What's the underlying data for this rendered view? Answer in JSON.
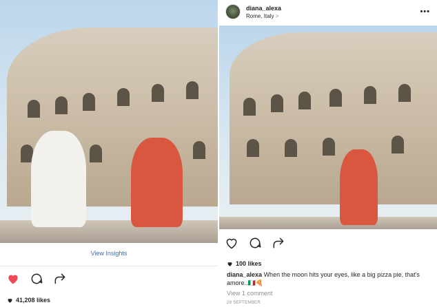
{
  "left_post": {
    "insights_label": "View Insights",
    "likes": "41,208 likes",
    "liked": true
  },
  "right_post": {
    "username": "diana_alexa",
    "location": "Rome, Italy",
    "location_chevron": ">",
    "more": "•••",
    "likes": "100 likes",
    "caption_user": "diana_alexa",
    "caption_text": "When the moon hits your eyes, like a big pizza pie, that's amore..🇮🇹🍕",
    "comments_link": "View 1 comment",
    "date": "28 SEPTEMBER"
  },
  "colors": {
    "heart_liked": "#ed4956",
    "link": "#3f6d9f",
    "muted": "#8e8e8e"
  },
  "icons": {
    "like": "heart-icon",
    "comment": "comment-icon",
    "share": "share-icon",
    "more": "more-icon"
  }
}
